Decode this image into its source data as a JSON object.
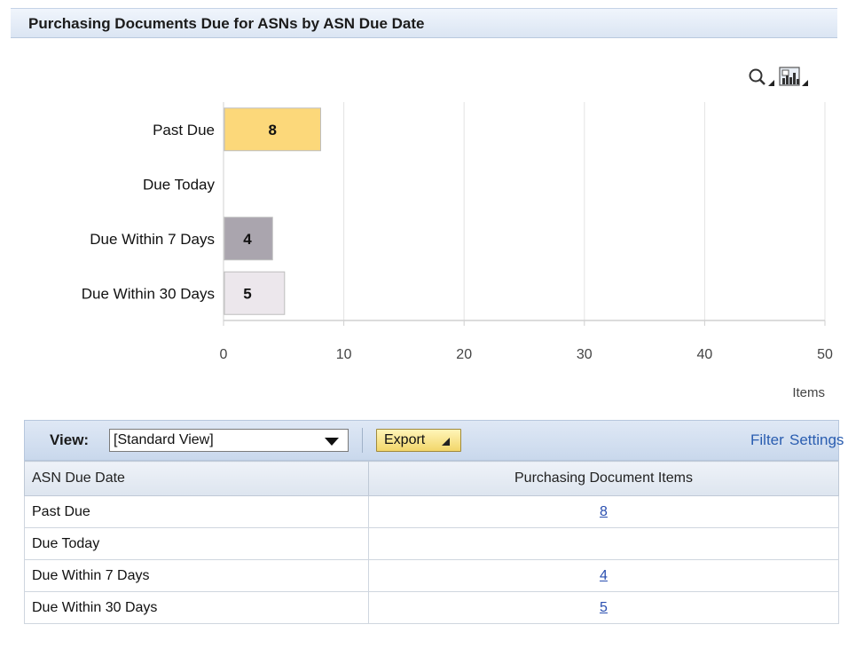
{
  "header": {
    "title": "Purchasing Documents Due for ASNs by ASN Due Date"
  },
  "toolbar_icons": {
    "zoom_icon": "magnifier-icon",
    "chart_type_icon": "chart-settings-icon"
  },
  "chart_data": {
    "type": "bar",
    "orientation": "horizontal",
    "categories": [
      "Past Due",
      "Due Today",
      "Due Within 7 Days",
      "Due Within 30 Days"
    ],
    "values": [
      8,
      null,
      4,
      5
    ],
    "data_labels": [
      "8",
      "",
      "4",
      "5"
    ],
    "colors": [
      "#fcd87a",
      "#ffffff",
      "#aaa5ae",
      "#ece7ec"
    ],
    "xlabel": "Items",
    "xlim": [
      0,
      50
    ],
    "xticks": [
      "0",
      "10",
      "20",
      "30",
      "40",
      "50"
    ],
    "grid": true
  },
  "table_toolbar": {
    "view_label": "View:",
    "view_value": "[Standard View]",
    "export_label": "Export",
    "filter_label": "Filter",
    "settings_label": "Settings"
  },
  "table": {
    "columns": [
      "ASN Due Date",
      "Purchasing Document Items"
    ],
    "rows": [
      {
        "date": "Past Due",
        "items": "8"
      },
      {
        "date": "Due Today",
        "items": ""
      },
      {
        "date": "Due Within 7 Days",
        "items": "4"
      },
      {
        "date": "Due Within 30 Days",
        "items": "5"
      }
    ]
  }
}
